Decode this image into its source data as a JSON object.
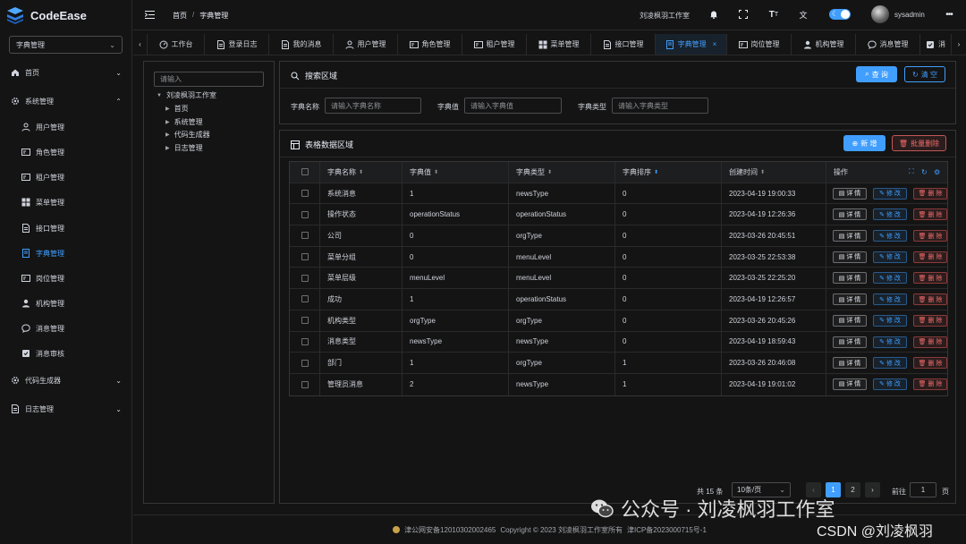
{
  "app": {
    "name": "CodeEase",
    "selector": "字典管理"
  },
  "sidebar": {
    "items": [
      {
        "label": "首页",
        "icon": "home-icon",
        "level": "top",
        "chevron": "⌄"
      },
      {
        "label": "系统管理",
        "icon": "gear-icon",
        "level": "top",
        "chevron": "⌃"
      },
      {
        "label": "用户管理",
        "icon": "user-icon",
        "level": "sub"
      },
      {
        "label": "角色管理",
        "icon": "id-card-icon",
        "level": "sub"
      },
      {
        "label": "租户管理",
        "icon": "id-card-icon",
        "level": "sub"
      },
      {
        "label": "菜单管理",
        "icon": "grid-icon",
        "level": "sub"
      },
      {
        "label": "接口管理",
        "icon": "doc-icon",
        "level": "sub"
      },
      {
        "label": "字典管理",
        "icon": "notebook-icon",
        "level": "sub",
        "active": true
      },
      {
        "label": "岗位管理",
        "icon": "id-card-icon",
        "level": "sub"
      },
      {
        "label": "机构管理",
        "icon": "user-filled-icon",
        "level": "sub"
      },
      {
        "label": "消息管理",
        "icon": "chat-icon",
        "level": "sub"
      },
      {
        "label": "消息审核",
        "icon": "stamp-icon",
        "level": "sub"
      },
      {
        "label": "代码生成器",
        "icon": "gear-icon",
        "level": "top",
        "chevron": "⌄"
      },
      {
        "label": "日志管理",
        "icon": "doc-icon",
        "level": "top",
        "chevron": "⌄"
      }
    ]
  },
  "header": {
    "breadcrumb": [
      "首页",
      "字典管理"
    ],
    "org": "刘凌枫羽工作室",
    "username": "sysadmin"
  },
  "tabs": [
    {
      "label": "工作台",
      "icon": "dashboard-icon"
    },
    {
      "label": "登录日志",
      "icon": "doc-icon"
    },
    {
      "label": "我的消息",
      "icon": "doc-icon"
    },
    {
      "label": "用户管理",
      "icon": "user-icon"
    },
    {
      "label": "角色管理",
      "icon": "id-card-icon"
    },
    {
      "label": "租户管理",
      "icon": "id-card-icon"
    },
    {
      "label": "菜单管理",
      "icon": "grid-icon"
    },
    {
      "label": "接口管理",
      "icon": "doc-icon"
    },
    {
      "label": "字典管理",
      "icon": "notebook-icon",
      "active": true,
      "closable": true
    },
    {
      "label": "岗位管理",
      "icon": "id-card-icon"
    },
    {
      "label": "机构管理",
      "icon": "user-filled-icon"
    },
    {
      "label": "消息管理",
      "icon": "chat-icon"
    },
    {
      "label": "消",
      "icon": "stamp-icon"
    }
  ],
  "tree": {
    "placeholder": "请输入",
    "root": "刘凌枫羽工作室",
    "children": [
      "首页",
      "系统管理",
      "代码生成器",
      "日志管理"
    ]
  },
  "search": {
    "title": "搜索区域",
    "query_btn": "查 询",
    "clear_btn": "清 空",
    "fields": [
      {
        "label": "字典名称",
        "placeholder": "请输入字典名称"
      },
      {
        "label": "字典值",
        "placeholder": "请输入字典值"
      },
      {
        "label": "字典类型",
        "placeholder": "请输入字典类型"
      }
    ]
  },
  "table": {
    "title": "表格数据区域",
    "add_btn": "新 增",
    "batch_delete_btn": "批量删除",
    "columns": [
      "字典名称",
      "字典值",
      "字典类型",
      "字典排序",
      "创建时间",
      "操作"
    ],
    "actions": {
      "detail": "详 情",
      "edit": "修 改",
      "delete": "删 除"
    },
    "rows": [
      [
        "系统消息",
        "1",
        "newsType",
        "0",
        "2023-04-19 19:00:33"
      ],
      [
        "操作状态",
        "operationStatus",
        "operationStatus",
        "0",
        "2023-04-19 12:26:36"
      ],
      [
        "公司",
        "0",
        "orgType",
        "0",
        "2023-03-26 20:45:51"
      ],
      [
        "菜单分组",
        "0",
        "menuLevel",
        "0",
        "2023-03-25 22:53:38"
      ],
      [
        "菜单层级",
        "menuLevel",
        "menuLevel",
        "0",
        "2023-03-25 22:25:20"
      ],
      [
        "成功",
        "1",
        "operationStatus",
        "0",
        "2023-04-19 12:26:57"
      ],
      [
        "机构类型",
        "orgType",
        "orgType",
        "0",
        "2023-03-26 20:45:26"
      ],
      [
        "消息类型",
        "newsType",
        "newsType",
        "0",
        "2023-04-19 18:59:43"
      ],
      [
        "部门",
        "1",
        "orgType",
        "1",
        "2023-03-26 20:46:08"
      ],
      [
        "管理员消息",
        "2",
        "newsType",
        "1",
        "2023-04-19 19:01:02"
      ]
    ]
  },
  "pagination": {
    "total": "共 15 条",
    "page_size": "10条/页",
    "pages": [
      "1",
      "2"
    ],
    "current": "1",
    "goto_label": "前往",
    "goto_value": "1",
    "page_suffix": "页"
  },
  "footer": {
    "police": "津公网安备12010302002465",
    "copyright": "Copyright © 2023 刘凌枫羽工作室所有",
    "icp": "津ICP备2023000715号-1"
  },
  "watermark": {
    "main": "公众号 · 刘凌枫羽工作室",
    "csdn": "CSDN @刘凌枫羽"
  },
  "colors": {
    "primary": "#409eff",
    "danger": "#f56c6c",
    "background": "#141414"
  }
}
